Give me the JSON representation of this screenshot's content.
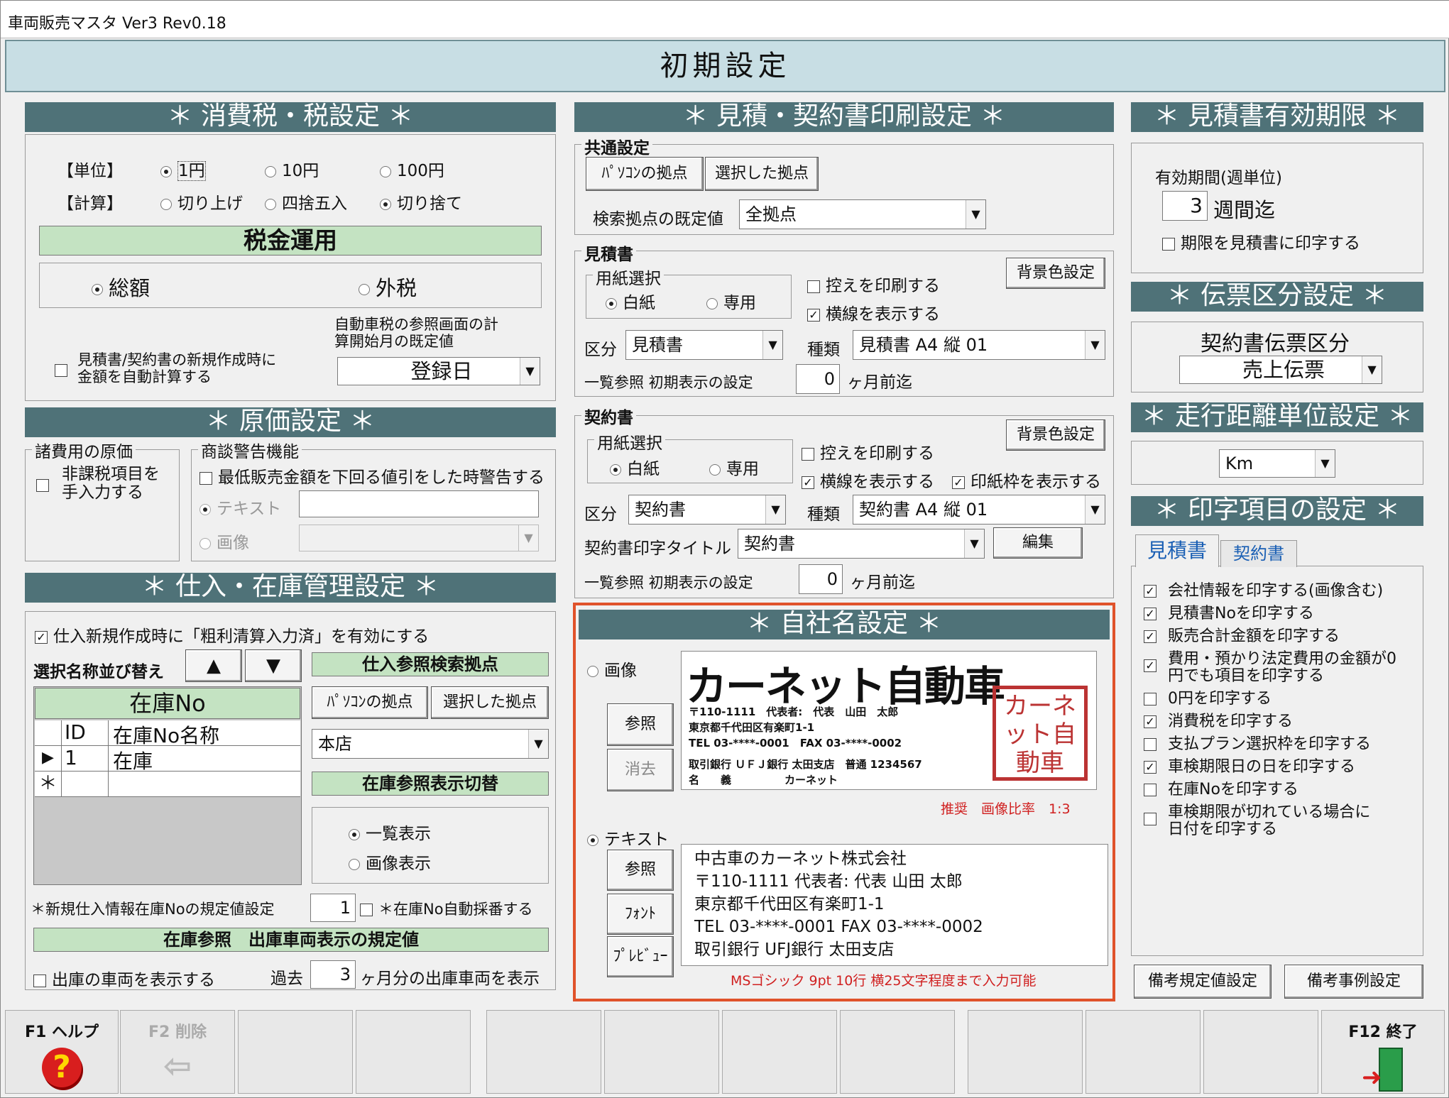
{
  "window": {
    "title": "車両販売マスタ Ver3 Rev0.18"
  },
  "header": {
    "title": "初期設定"
  },
  "tax": {
    "section_title": "＊ 消費税・税設定 ＊",
    "unit_label": "【単位】",
    "unit_opts": [
      "1円",
      "10円",
      "100円"
    ],
    "calc_label": "【計算】",
    "calc_opts": [
      "切り上げ",
      "四捨五入",
      "切り捨て"
    ],
    "op_title": "税金運用",
    "op_opts": [
      "総額",
      "外税"
    ],
    "auto_calc": "見積書/契約書の新規作成時に金額を自動計算する",
    "auto_calc_l1": "見積書/契約書の新規作成時に",
    "auto_calc_l2": "金額を自動計算する",
    "car_tax_l1": "自動車税の参照画面の計",
    "car_tax_l2": "算開始月の既定値",
    "car_tax_value": "登録日"
  },
  "cost": {
    "section_title": "＊ 原価設定 ＊",
    "misc_group": "諸費用の原価",
    "nontax_l1": "非課税項目を",
    "nontax_l2": "手入力する",
    "warn_group": "商談警告機能",
    "warn_chk": "最低販売金額を下回る値引をした時警告する",
    "opt_text": "テキスト",
    "opt_image": "画像"
  },
  "stock": {
    "section_title": "＊ 仕入・在庫管理設定 ＊",
    "gross_chk": "仕入新規作成時に「粗利清算入力済」を有効にする",
    "sort_label": "選択名称並び替え",
    "up": "▲",
    "down": "▼",
    "grid_title": "在庫No",
    "col_id": "ID",
    "col_name": "在庫No名称",
    "row_marker": "▶",
    "row_id": "1",
    "row_name": "在庫",
    "new_marker": "＊",
    "search_base": "仕入参照検索拠点",
    "pc_base": "ﾊﾟｿｺﾝの拠点",
    "sel_base": "選択した拠点",
    "base_value": "本店",
    "disp_switch": "在庫参照表示切替",
    "disp_list": "一覧表示",
    "disp_image": "画像表示",
    "default_no_label": "＊新規仕入情報在庫Noの規定値設定",
    "default_no": "1",
    "auto_no": "＊在庫No自動採番する",
    "outbound_title": "在庫参照　出庫車両表示の規定値",
    "show_out": "出庫の車両を表示する",
    "past": "過去",
    "past_value": "3",
    "past_suffix": "ヶ月分の出庫車両を表示"
  },
  "print": {
    "section_title": "＊ 見積・契約書印刷設定 ＊",
    "common": "共通設定",
    "pc_base": "ﾊﾟｿｺﾝの拠点",
    "sel_base": "選択した拠点",
    "default_base_label": "検索拠点の既定値",
    "default_base": "全拠点",
    "estimate": "見積書",
    "contract": "契約書",
    "paper": "用紙選択",
    "plain": "白紙",
    "dedicated": "専用",
    "copy": "控えを印刷する",
    "lines": "横線を表示する",
    "stamp": "印紙枠を表示する",
    "bgcolor": "背景色設定",
    "kubun": "区分",
    "shurui": "種類",
    "est_kubun": "見積書",
    "est_shurui": "見積書 A4 縦 01",
    "con_kubun": "契約書",
    "con_shurui": "契約書 A4 縦 01",
    "list_label": "一覧参照 初期表示の設定",
    "months": "0",
    "months_suffix": "ヶ月前迄",
    "con_title_label": "契約書印字タイトル",
    "con_title": "契約書",
    "edit": "編集"
  },
  "company": {
    "section_title": "＊ 自社名設定 ＊",
    "opt_image": "画像",
    "opt_text": "テキスト",
    "ref": "参照",
    "del": "消去",
    "font": "ﾌｫﾝﾄ",
    "preview": "ﾌﾟﾚﾋﾞｭｰ",
    "logo_name": "カーネット自動車",
    "logo_l1": "〒110-1111　代表者:　代表　山田　太郎",
    "logo_l2": "東京都千代田区有楽町1-1",
    "logo_l3": "TEL 03-****-0001　FAX 03-****-0002",
    "logo_l4": "取引銀行 ＵＦＪ銀行 太田支店　普通 1234567",
    "logo_l5": "名　　義　　　　　カーネット",
    "seal_text": "カーネット自動車",
    "ratio": "推奨　画像比率　1:3",
    "lines": [
      "中古車のカーネット株式会社",
      "〒110-1111 代表者: 代表 山田 太郎",
      "東京都千代田区有楽町1-1",
      "TEL 03-****-0001 FAX 03-****-0002",
      "取引銀行 UFJ銀行 太田支店"
    ],
    "hint": "MSゴシック 9pt 10行 横25文字程度まで入力可能"
  },
  "validity": {
    "section_title": "＊ 見積書有効期限 ＊",
    "label": "有効期間(週単位)",
    "value": "3",
    "suffix": "週間迄",
    "print_chk": "期限を見積書に印字する"
  },
  "slip": {
    "section_title": "＊ 伝票区分設定 ＊",
    "label": "契約書伝票区分",
    "value": "売上伝票"
  },
  "distance": {
    "section_title": "＊ 走行距離単位設定 ＊",
    "value": "Km"
  },
  "items": {
    "section_title": "＊ 印字項目の設定 ＊",
    "tab_est": "見積書",
    "tab_con": "契約書",
    "list": [
      {
        "label": "会社情報を印字する(画像含む)",
        "checked": true
      },
      {
        "label": "見積書Noを印字する",
        "checked": true
      },
      {
        "label": "販売合計金額を印字する",
        "checked": true
      },
      {
        "label": "費用・預かり法定費用の金額が0円でも項目を印字する",
        "checked": true
      },
      {
        "label": "0円を印字する",
        "checked": false
      },
      {
        "label": "消費税を印字する",
        "checked": true
      },
      {
        "label": "支払プラン選択枠を印字する",
        "checked": false
      },
      {
        "label": "車検期限日の日を印字する",
        "checked": true
      },
      {
        "label": "在庫Noを印字する",
        "checked": false
      },
      {
        "label": "車検期限が切れている場合に日付を印字する",
        "checked": false
      }
    ],
    "item3_l1": "費用・預かり法定費用の金額が0",
    "item3_l2": "円でも項目を印字する",
    "item9_l1": "車検期限が切れている場合に",
    "item9_l2": "日付を印字する",
    "remark_default": "備考規定値設定",
    "remark_example": "備考事例設定"
  },
  "fkeys": {
    "f1": "F1 ヘルプ",
    "f2": "F2 削除",
    "f12": "F12 終了"
  }
}
